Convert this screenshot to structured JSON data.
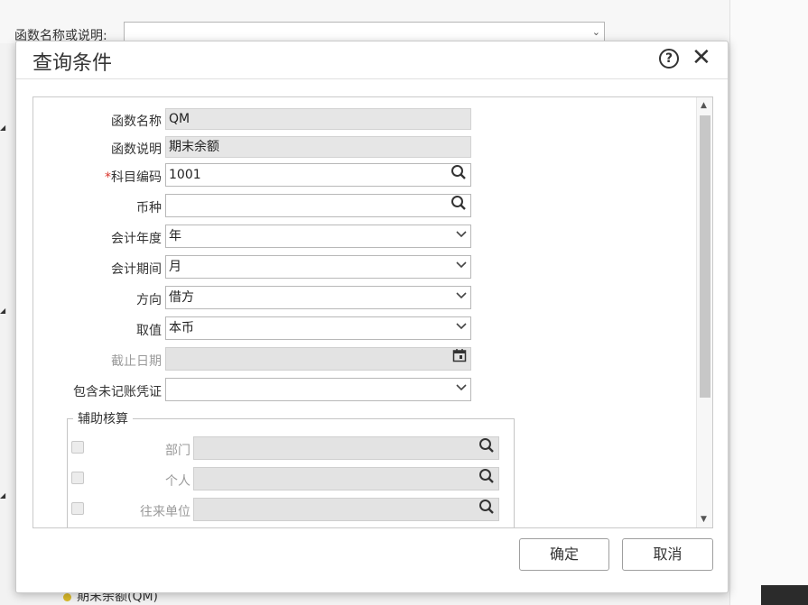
{
  "background": {
    "filter_label": "函数名称或说明:",
    "filter_value": "",
    "bottom_item": "期末余额(QM)"
  },
  "dialog": {
    "title": "查询条件",
    "fields": {
      "func_name": {
        "label": "函数名称",
        "value": "QM"
      },
      "func_desc": {
        "label": "函数说明",
        "value": "期末余额"
      },
      "subject_code": {
        "required_mark": "*",
        "label": "科目编码",
        "value": "1001"
      },
      "currency": {
        "label": "币种",
        "value": ""
      },
      "fiscal_year": {
        "label": "会计年度",
        "value": "年"
      },
      "fiscal_period": {
        "label": "会计期间",
        "value": "月"
      },
      "direction": {
        "label": "方向",
        "value": "借方"
      },
      "take_value": {
        "label": "取值",
        "value": "本币"
      },
      "cutoff_date": {
        "label": "截止日期",
        "value": ""
      },
      "include_unposted": {
        "label": "包含未记账凭证",
        "value": ""
      }
    },
    "aux": {
      "legend": "辅助核算",
      "items": [
        {
          "label": "部门",
          "value": ""
        },
        {
          "label": "个人",
          "value": ""
        },
        {
          "label": "往来单位",
          "value": ""
        }
      ]
    },
    "buttons": {
      "confirm": "确定",
      "cancel": "取消"
    }
  }
}
